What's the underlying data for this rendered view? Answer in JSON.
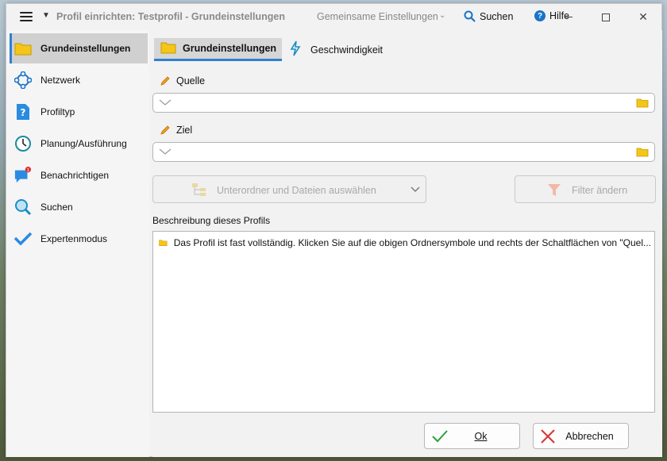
{
  "titlebar": {
    "title": "Profil einrichten: Testprofil - Grundeinstellungen",
    "shared_settings": "Gemeinsame Einstellungen",
    "search": "Suchen",
    "help": "Hilfe"
  },
  "sidebar": {
    "items": [
      {
        "label": "Grundeinstellungen",
        "icon": "folder-icon",
        "active": true
      },
      {
        "label": "Netzwerk",
        "icon": "network-icon"
      },
      {
        "label": "Profiltyp",
        "icon": "help-document-icon"
      },
      {
        "label": "Planung/Ausführung",
        "icon": "clock-icon"
      },
      {
        "label": "Benachrichtigen",
        "icon": "notification-bubble-icon",
        "badge": "1"
      },
      {
        "label": "Suchen",
        "icon": "magnifier-icon"
      },
      {
        "label": "Expertenmodus",
        "icon": "checkmark-icon"
      }
    ]
  },
  "tabs": [
    {
      "label": "Grundeinstellungen",
      "active": true
    },
    {
      "label": "Geschwindigkeit"
    }
  ],
  "source": {
    "label": "Quelle",
    "value": ""
  },
  "target": {
    "label": "Ziel",
    "value": ""
  },
  "buttons": {
    "subfolders": "Unterordner und Dateien auswählen",
    "filter": "Filter ändern",
    "ok": "Ok",
    "cancel": "Abbrechen"
  },
  "description": {
    "label": "Beschreibung dieses Profils",
    "text": "Das Profil ist fast vollständig. Klicken Sie auf die obigen Ordnersymbole und rechts der Schaltflächen von \"Quel..."
  },
  "colors": {
    "accent": "#2f7fd0",
    "folder": "#f5c518",
    "ok_check": "#2e9e3e",
    "cancel_x": "#d43c3c"
  }
}
